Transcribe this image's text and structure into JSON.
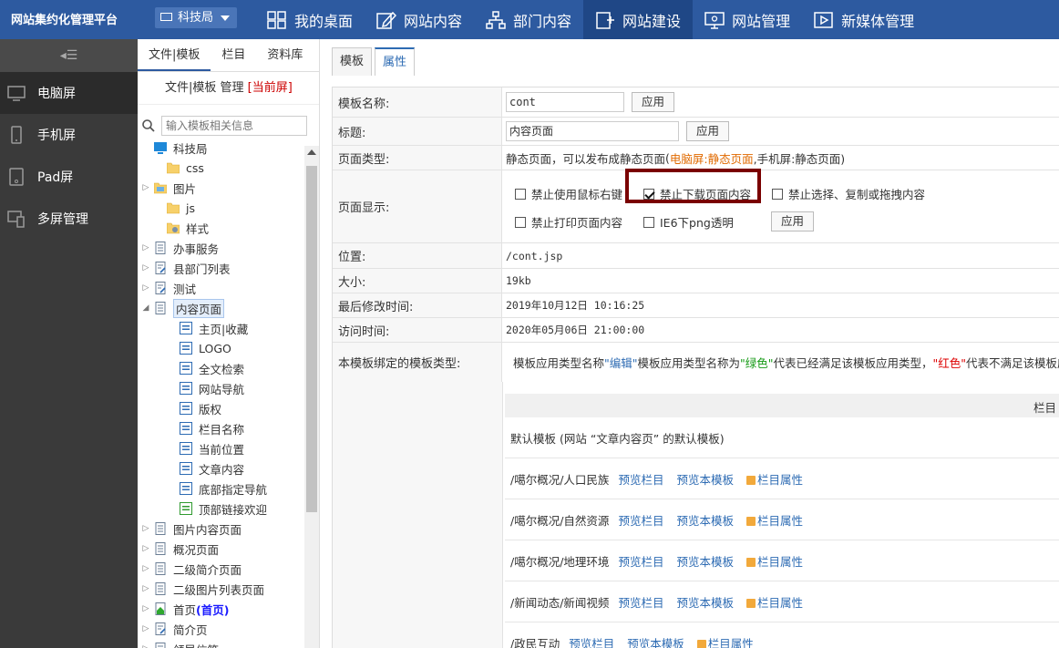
{
  "app": {
    "title": "网站集约化管理平台",
    "org_selector": "科技局"
  },
  "nav": [
    {
      "label": "我的桌面",
      "icon": "grid-icon"
    },
    {
      "label": "网站内容",
      "icon": "edit-icon"
    },
    {
      "label": "部门内容",
      "icon": "org-chart-icon"
    },
    {
      "label": "网站建设",
      "icon": "build-icon"
    },
    {
      "label": "网站管理",
      "icon": "monitor-icon"
    },
    {
      "label": "新媒体管理",
      "icon": "media-icon"
    }
  ],
  "left_sidebar": {
    "items": [
      {
        "label": "电脑屏",
        "icon": "desktop-icon"
      },
      {
        "label": "手机屏",
        "icon": "phone-icon"
      },
      {
        "label": "Pad屏",
        "icon": "tablet-icon"
      },
      {
        "label": "多屏管理",
        "icon": "multiscreen-icon"
      }
    ]
  },
  "tree_panel": {
    "tabs": [
      "文件|模板",
      "栏目",
      "资料库"
    ],
    "header": "文件|模板 管理",
    "header_current": "[当前屏]",
    "search_placeholder": "输入模板相关信息",
    "nodes": [
      {
        "label": "科技局",
        "icon": "site-icon"
      },
      {
        "label": "css",
        "icon": "folder-icon"
      },
      {
        "label": "图片",
        "icon": "image-folder-icon"
      },
      {
        "label": "js",
        "icon": "folder-icon"
      },
      {
        "label": "样式",
        "icon": "style-folder-icon"
      },
      {
        "label": "办事服务",
        "icon": "page-icon"
      },
      {
        "label": "县部门列表",
        "icon": "page-link-icon"
      },
      {
        "label": "测试",
        "icon": "page-link-icon"
      },
      {
        "label": "内容页面",
        "icon": "page-icon"
      },
      {
        "label": "主页|收藏",
        "icon": "block-icon"
      },
      {
        "label": "LOGO",
        "icon": "block-icon"
      },
      {
        "label": "全文检索",
        "icon": "block-icon"
      },
      {
        "label": "网站导航",
        "icon": "block-icon"
      },
      {
        "label": "版权",
        "icon": "block-icon"
      },
      {
        "label": "栏目名称",
        "icon": "block-icon"
      },
      {
        "label": "当前位置",
        "icon": "block-icon"
      },
      {
        "label": "文章内容",
        "icon": "block-icon"
      },
      {
        "label": "底部指定导航",
        "icon": "block-icon"
      },
      {
        "label": "顶部链接欢迎",
        "icon": "block-green-icon"
      },
      {
        "label": "图片内容页面",
        "icon": "page-icon"
      },
      {
        "label": "概况页面",
        "icon": "page-icon"
      },
      {
        "label": "二级简介页面",
        "icon": "page-icon"
      },
      {
        "label": "二级图片列表页面",
        "icon": "page-icon"
      },
      {
        "label": "首页",
        "suffix": "(首页)",
        "icon": "home-page-icon"
      },
      {
        "label": "简介页",
        "icon": "page-link-icon"
      },
      {
        "label": "领导信箱",
        "icon": "page-icon"
      }
    ]
  },
  "main": {
    "tabs": [
      "模板",
      "属性"
    ],
    "props": {
      "name_label": "模板名称:",
      "name_value": "cont",
      "title_label": "标题:",
      "title_value": "内容页面",
      "apply": "应用",
      "type_label": "页面类型:",
      "type_text": "静态页面，可以发布成静态页面",
      "type_paren_open": "(",
      "type_highlight": "电脑屏:静态页面",
      "type_rest": ",手机屏:静态页面)",
      "display_label": "页面显示:",
      "opt_right_click": "禁止使用鼠标右键",
      "opt_download": "禁止下载页面内容",
      "opt_select": "禁止选择、复制或拖拽内容",
      "opt_print": "禁止打印页面内容",
      "opt_png": "IE6下png透明",
      "location_label": "位置:",
      "location_value": "/cont.jsp",
      "size_label": "大小:",
      "size_value": "19kb",
      "modified_label": "最后修改时间:",
      "modified_value": "2019年10月12日 10:16:25",
      "access_label": "访问时间:",
      "access_value": "2020年05月06日 21:00:00",
      "binding_label": "本模板绑定的模板类型:",
      "binding_desc_1": "模板应用类型名称",
      "binding_desc_2": "\"编辑\"",
      "binding_desc_3": "模板应用类型名称为",
      "binding_desc_4": "\"绿色\"",
      "binding_desc_5": "代表已经满足该模板应用类型，",
      "binding_desc_6": "\"红色\"",
      "binding_desc_7": "代表不满足该模板应"
    },
    "grid": {
      "header_col": "栏目",
      "default_row": "默认模板 (网站 “文章内容页” 的默认模板)",
      "rows": [
        {
          "path": "/噶尔概况/人口民族"
        },
        {
          "path": "/噶尔概况/自然资源"
        },
        {
          "path": "/噶尔概况/地理环境"
        },
        {
          "path": "/新闻动态/新闻视频"
        },
        {
          "path": "/政民互动"
        }
      ],
      "link_preview_col": "预览栏目",
      "link_preview_tpl": "预览本模板",
      "link_props": "栏目属性"
    }
  }
}
